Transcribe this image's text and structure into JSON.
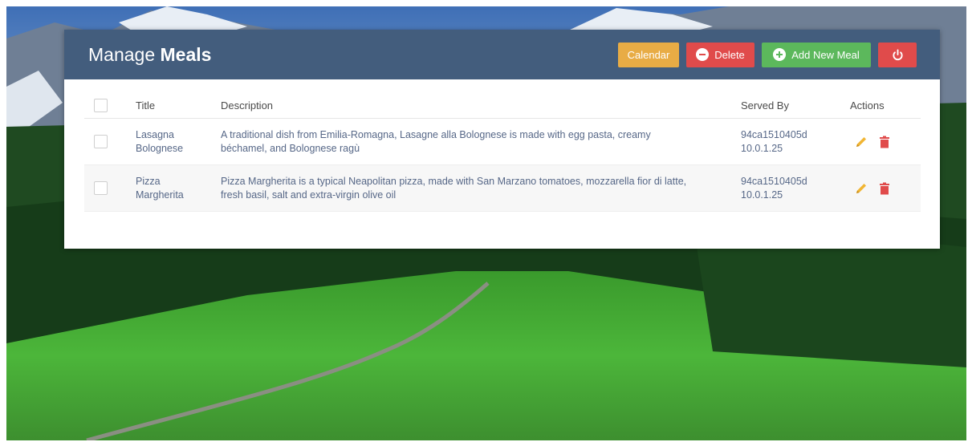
{
  "header": {
    "title_prefix": "Manage",
    "title_bold": "Meals",
    "calendar_label": "Calendar",
    "delete_label": "Delete",
    "add_label": "Add New Meal"
  },
  "table": {
    "columns": [
      "Title",
      "Description",
      "Served By",
      "Actions"
    ],
    "rows": [
      {
        "title_line1": "Lasagna",
        "title_line2": "Bolognese",
        "desc_line1": "A traditional dish from Emilia-Romagna, Lasagne alla Bolognese is made with egg pasta, creamy",
        "desc_line2": "béchamel, and Bolognese ragù",
        "served_host": "94ca1510405d",
        "served_ip": "10.0.1.25"
      },
      {
        "title_line1": "Pizza",
        "title_line2": "Margherita",
        "desc_line1": "Pizza Margherita is a typical Neapolitan pizza, made with San Marzano tomatoes, mozzarella fior di latte,",
        "desc_line2": "fresh basil, salt and extra-virgin olive oil",
        "served_host": "94ca1510405d",
        "served_ip": "10.0.1.25"
      }
    ]
  },
  "colors": {
    "header_bg": "#435d7d",
    "calendar": "#e8ac45",
    "delete": "#e04b4b",
    "add": "#5cb85c",
    "edit_icon": "#f1b533",
    "trash_icon": "#e04b4b"
  },
  "icons": {
    "delete": "minus-circle-icon",
    "add": "plus-circle-icon",
    "power": "power-icon",
    "edit": "pencil-icon",
    "trash": "trash-icon"
  }
}
